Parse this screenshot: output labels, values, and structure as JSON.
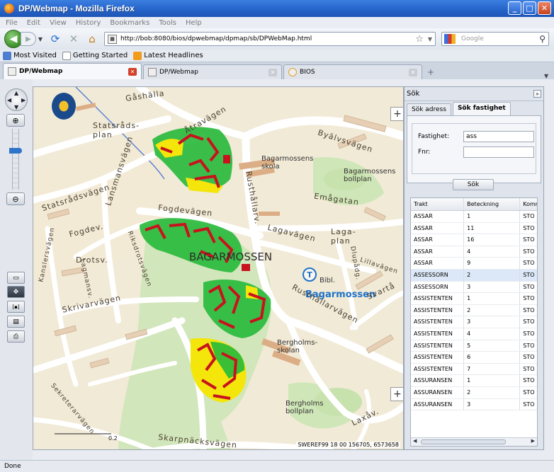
{
  "window": {
    "title": "DP/Webmap - Mozilla Firefox",
    "min": "_",
    "max": "□",
    "close": "✕"
  },
  "menu": [
    "File",
    "Edit",
    "View",
    "History",
    "Bookmarks",
    "Tools",
    "Help"
  ],
  "nav": {
    "url": "http://bob:8080/bios/dpwebmap/dpmap/sb/DPWebMap.html",
    "search_placeholder": "Google"
  },
  "bookmarks": [
    "Most Visited",
    "Getting Started",
    "Latest Headlines"
  ],
  "tabs": [
    {
      "label": "DP/Webmap",
      "active": true
    },
    {
      "label": "DP/Webmap",
      "active": false
    },
    {
      "label": "BIOS",
      "active": false
    }
  ],
  "map": {
    "labels": {
      "gashalla": "Gåshälla",
      "statsradsplan": "Statsråds- plan",
      "statsradsvagen": "Statsrådsvägen",
      "lansmansvagen": "Lansmansvägen",
      "atravagen": "Åtravägen",
      "byalvsvagen": "Byälvsvägen",
      "rusthallarv": "Rusthållarv.",
      "bagarmossens_skola": "Bagarmossens skola",
      "bagarmossens_bollplan": "Bagarmossens bollplan",
      "emagatan": "Emågatan",
      "lagavagen": "Lagavägen",
      "lagaplan": "Laga- plan",
      "fogdevagen": "Fogdevägen",
      "fogdev": "Fogdev.",
      "drotsv": "Drotsv.",
      "kanslersvagen": "Kanslersvägen",
      "riksdrotsvagen": "Riksdrotsvägen",
      "lagmansv": "Lagmansv.",
      "bagarmossen": "BAGARMOSSEN",
      "bagarmossen_station": "Bagarmossen",
      "rusthallarvagen": "Rusthållarvägen",
      "lillavagen": "Lillavägen",
      "svartan": "Svartå",
      "dlupadg": "Dlupådg.",
      "bibl": "Bibl.",
      "skrivarvagen": "Skrivarvägen",
      "bergholmsskolan": "Bergholms- skolan",
      "bergholms_bollplan": "Bergholms bollplan",
      "sekretevagen": "Sekreterarvägen",
      "skarpnacksvagen": "Skarpnäcksvägen",
      "laxav": "Laxåv."
    },
    "scale_label": "0.2",
    "coords": "SWEREF99 18 00 156705, 6573658",
    "zoom_in": "+",
    "zoom_out": "−",
    "corner_plus": "+"
  },
  "tools": {
    "zoom_in": "⊕",
    "zoom_out": "⊖",
    "pan_up": "▲",
    "pan_down": "▼",
    "pan_left": "◀",
    "pan_right": "▶"
  },
  "panel": {
    "title": "Sök",
    "collapse": "»",
    "tabs": [
      "Sök adress",
      "Sök fastighet"
    ],
    "active_tab": 1,
    "fields": {
      "fastighet_label": "Fastighet:",
      "fastighet_value": "ass",
      "fnr_label": "Fnr:",
      "fnr_value": ""
    },
    "search_button": "Sök",
    "columns": [
      "Trakt",
      "Beteckning",
      "Kommun"
    ],
    "rows": [
      [
        "ASSAR",
        "1",
        "STO"
      ],
      [
        "ASSAR",
        "11",
        "STO"
      ],
      [
        "ASSAR",
        "16",
        "STO"
      ],
      [
        "ASSAR",
        "4",
        "STO"
      ],
      [
        "ASSAR",
        "9",
        "STO"
      ],
      [
        "ASSESSORN",
        "2",
        "STO"
      ],
      [
        "ASSESSORN",
        "3",
        "STO"
      ],
      [
        "ASSISTENTEN",
        "1",
        "STO"
      ],
      [
        "ASSISTENTEN",
        "2",
        "STO"
      ],
      [
        "ASSISTENTEN",
        "3",
        "STO"
      ],
      [
        "ASSISTENTEN",
        "4",
        "STO"
      ],
      [
        "ASSISTENTEN",
        "5",
        "STO"
      ],
      [
        "ASSISTENTEN",
        "6",
        "STO"
      ],
      [
        "ASSISTENTEN",
        "7",
        "STO"
      ],
      [
        "ASSURANSEN",
        "1",
        "STO"
      ],
      [
        "ASSURANSEN",
        "2",
        "STO"
      ],
      [
        "ASSURANSEN",
        "3",
        "STO"
      ]
    ],
    "highlighted_row": 5
  },
  "status": "Done",
  "colors": {
    "accent": "#2563c8",
    "road": "#ffffff",
    "park": "#cfe6b8",
    "building": "#d9a983",
    "highlight_red": "#c8121e",
    "highlight_yellow": "#f4e60a",
    "highlight_green": "#26b93a"
  }
}
